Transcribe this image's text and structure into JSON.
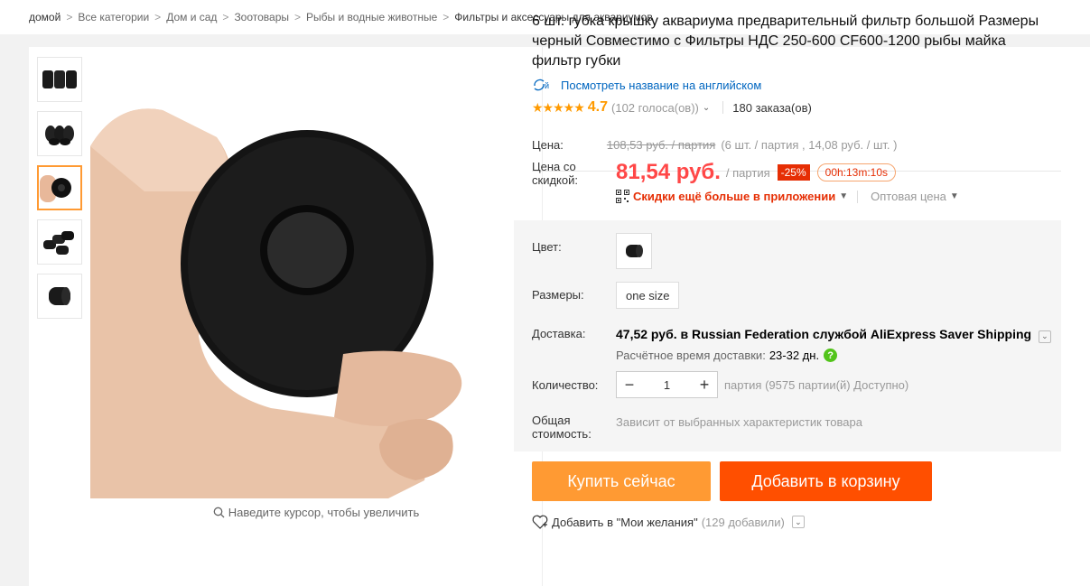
{
  "breadcrumb": [
    {
      "label": "домой"
    },
    {
      "label": "Все категории"
    },
    {
      "label": "Дом и сад"
    },
    {
      "label": "Зоотовары"
    },
    {
      "label": "Рыбы и водные животные"
    },
    {
      "label": "Фильтры и аксессуары для аквариумов"
    }
  ],
  "product": {
    "title": "6 шт. губка крышку аквариума предварительный фильтр большой Размеры черный Совместимо с Фильтры НДС 250-600 CF600-1200 рыбы майка фильтр губки",
    "translate_link": "Посмотреть название на английском",
    "rating": "4.7",
    "votes": "(102 голоса(ов))",
    "orders": "180 заказа(ов)",
    "zoom_hint": "Наведите курсор, чтобы увеличить"
  },
  "price": {
    "label": "Цена:",
    "old": "108,53 руб. / партия",
    "old_note": "(6 шт. / партия , 14,08 руб. / шт. )",
    "discount_label": "Цена со скидкой:",
    "new": "81,54 руб.",
    "per_lot": "/ партия",
    "badge": "-25%",
    "timer": "00h:13m:10s",
    "app_discount": "Скидки ещё больше в приложении",
    "wholesale": "Оптовая цена"
  },
  "options": {
    "color_label": "Цвет:",
    "size_label": "Размеры:",
    "size_value": "one size",
    "delivery_label": "Доставка:",
    "delivery_price": "47,52 руб.",
    "delivery_text": " в Russian Federation службой AliExpress Saver Shipping",
    "delivery_time_label": "Расчётное время доставки:",
    "delivery_days": "23-32  дн.",
    "qty_label": "Количество:",
    "qty_value": "1",
    "qty_note": "партия (9575 партии(й) Доступно)",
    "total_label": "Общая стоимость:",
    "total_note": "Зависит от выбранных характеристик товара"
  },
  "actions": {
    "buy": "Купить сейчас",
    "cart": "Добавить в корзину",
    "wish": "Добавить в \"Мои желания\"",
    "wish_count": "(129 добавили)"
  },
  "colors": {
    "accent_orange": "#ff9a33",
    "cart_red": "#ff4f00",
    "price_red": "#ff4747",
    "link_blue": "#0066c0"
  }
}
